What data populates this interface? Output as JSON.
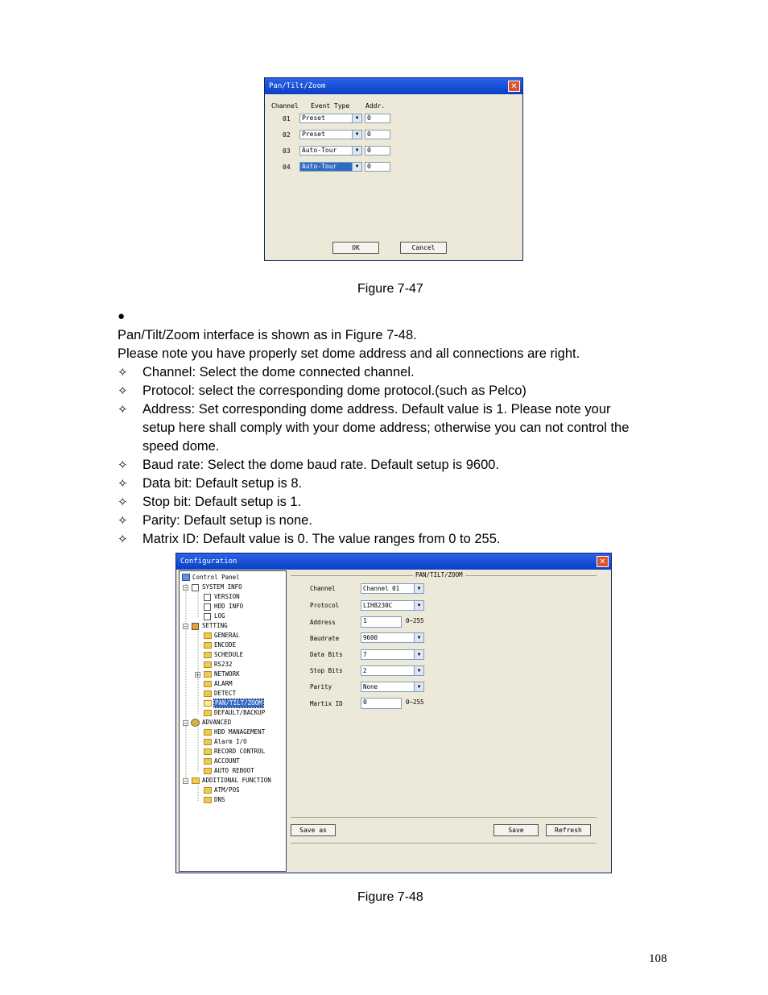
{
  "dialog1": {
    "title": "Pan/Tilt/Zoom",
    "headers": [
      "Channel",
      "Event Type",
      "Addr."
    ],
    "rows": [
      {
        "channel": "01",
        "event": "Preset",
        "addr": "0"
      },
      {
        "channel": "02",
        "event": "Preset",
        "addr": "0"
      },
      {
        "channel": "03",
        "event": "Auto-Tour",
        "addr": "0"
      },
      {
        "channel": "04",
        "event": "Auto-Tour",
        "addr": "0"
      }
    ],
    "ok": "OK",
    "cancel": "Cancel"
  },
  "fig1": "Figure 7-47",
  "bullet": "●",
  "intro1": "Pan/Tilt/Zoom interface is shown as in Figure 7-48.",
  "intro2": "Please note you have properly set dome address and all connections are right.",
  "star": "✧",
  "items": [
    "Channel: Select the dome connected channel.",
    "Protocol: select the corresponding dome protocol.(such as Pelco)",
    "Address: Set corresponding dome address. Default value is 1. Please note your",
    "setup here shall comply with your dome address; otherwise you can not control the",
    "speed dome.",
    "Baud rate: Select the dome baud rate. Default setup is 9600.",
    "Data bit: Default setup is 8.",
    "Stop bit: Default setup is 1.",
    "Parity: Default setup is none.",
    "Matrix ID: Default value is 0. The value ranges from 0 to 255."
  ],
  "dialog2": {
    "title": "Configuration",
    "tree": {
      "root": "Control Panel",
      "system_info": "SYSTEM INFO",
      "version": "VERSION",
      "hdd_info": "HDD INFO",
      "log": "LOG",
      "setting": "SETTING",
      "general": "GENERAL",
      "encode": "ENCODE",
      "schedule": "SCHEDULE",
      "rs232": "RS232",
      "network": "NETWORK",
      "alarm": "ALARM",
      "detect": "DETECT",
      "ptz": "PAN/TILT/ZOOM",
      "default_backup": "DEFAULT/BACKUP",
      "advanced": "ADVANCED",
      "hdd_management": "HDD MANAGEMENT",
      "alarm_io": "Alarm I/O",
      "record_control": "RECORD CONTROL",
      "account": "ACCOUNT",
      "auto_reboot": "AUTO REBOOT",
      "additional": "ADDITIONAL FUNCTION",
      "atm_pos": "ATM/POS",
      "dns": "DNS"
    },
    "group": "PAN/TILT/ZOOM",
    "fields": {
      "channel_label": "Channel",
      "channel_value": "Channel 01",
      "protocol_label": "Protocol",
      "protocol_value": "LIH8230C",
      "address_label": "Address",
      "address_value": "1",
      "address_range": "0~255",
      "baud_label": "Baudrate",
      "baud_value": "9600",
      "databits_label": "Data Bits",
      "databits_value": "7",
      "stopbits_label": "Stop Bits",
      "stopbits_value": "2",
      "parity_label": "Parity",
      "parity_value": "None",
      "matrix_label": "Martix ID",
      "matrix_value": "0",
      "matrix_range": "0~255"
    },
    "save_as": "Save as",
    "save": "Save",
    "refresh": "Refresh"
  },
  "fig2": "Figure 7-48",
  "page_number": "108"
}
